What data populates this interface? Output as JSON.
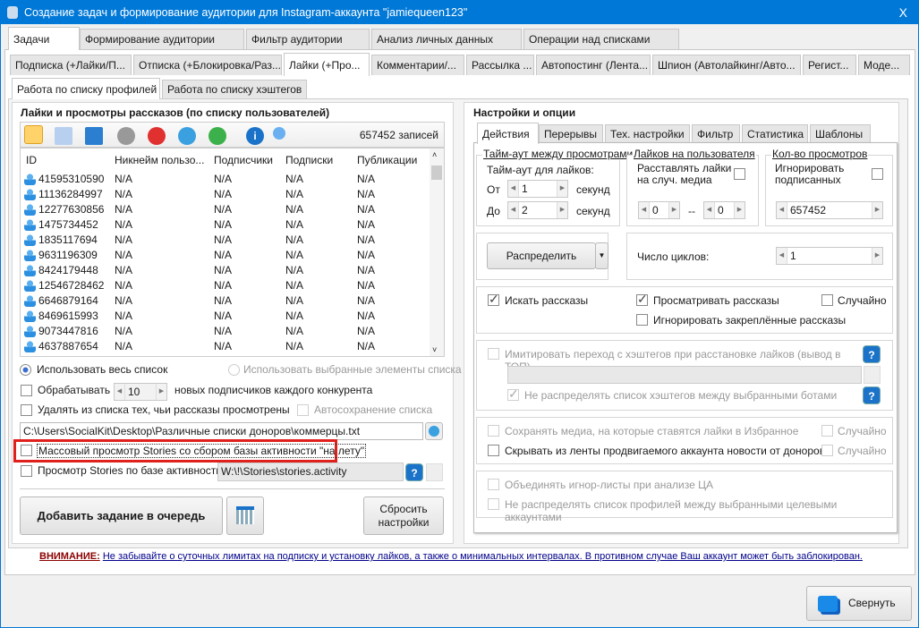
{
  "window": {
    "title": "Создание задач и формирование аудитории для Instagram-аккаунта \"jamiequeen123\"",
    "close": "X"
  },
  "main_tabs": [
    "Задачи",
    "Формирование аудитории",
    "Фильтр аудитории",
    "Анализ личных данных",
    "Операции над списками"
  ],
  "sub_tabs": [
    "Подписка (+Лайки/П...",
    "Отписка (+Блокировка/Раз...",
    "Лайки (+Про...",
    "Комментарии/...",
    "Рассылка ...",
    "Автопостинг (Лента...",
    "Шпион (Автолайкинг/Авто...",
    "Регист...",
    "Моде..."
  ],
  "mode_tabs": [
    "Работа по списку профилей",
    "Работа по списку хэштегов"
  ],
  "left": {
    "title": "Лайки и просмотры рассказов (по списку пользователей)",
    "record_count": "657452 записей",
    "columns": [
      "ID",
      "Никнейм пользо...",
      "Подписчики",
      "Подписки",
      "Публикации"
    ],
    "rows": [
      [
        "41595310590",
        "N/A",
        "N/A",
        "N/A",
        "N/A"
      ],
      [
        "11136284997",
        "N/A",
        "N/A",
        "N/A",
        "N/A"
      ],
      [
        "12277630856",
        "N/A",
        "N/A",
        "N/A",
        "N/A"
      ],
      [
        "1475734452",
        "N/A",
        "N/A",
        "N/A",
        "N/A"
      ],
      [
        "1835117694",
        "N/A",
        "N/A",
        "N/A",
        "N/A"
      ],
      [
        "9631196309",
        "N/A",
        "N/A",
        "N/A",
        "N/A"
      ],
      [
        "8424179448",
        "N/A",
        "N/A",
        "N/A",
        "N/A"
      ],
      [
        "12546728462",
        "N/A",
        "N/A",
        "N/A",
        "N/A"
      ],
      [
        "6646879164",
        "N/A",
        "N/A",
        "N/A",
        "N/A"
      ],
      [
        "8469615993",
        "N/A",
        "N/A",
        "N/A",
        "N/A"
      ],
      [
        "9073447816",
        "N/A",
        "N/A",
        "N/A",
        "N/A"
      ],
      [
        "4637887654",
        "N/A",
        "N/A",
        "N/A",
        "N/A"
      ]
    ],
    "radio_all": "Использовать весь список",
    "radio_selected": "Использовать выбранные элементы списка",
    "process_label": "Обрабатывать",
    "process_value": "10",
    "process_suffix": "новых подписчиков каждого конкурента",
    "remove_label": "Удалять из списка тех, чьи рассказы просмотрены",
    "autosave_label": "Автосохранение списка",
    "path": "C:\\Users\\SocialKit\\Desktop\\Различные списки доноров\\коммерцы.txt",
    "mass_view_label": "Массовый просмотр Stories со сбором базы активности \"на лету\"",
    "activity_label": "Просмотр Stories по базе активности:",
    "activity_path": "W:\\!\\Stories\\stories.activity",
    "add_task": "Добавить задание в очередь",
    "reset": [
      "Сбросить",
      "настройки"
    ]
  },
  "right": {
    "title": "Настройки и опции",
    "tabs": [
      "Действия",
      "Перерывы",
      "Тех. настройки",
      "Фильтр",
      "Статистика",
      "Шаблоны"
    ],
    "timeout_title": "Тайм-аут между просмотрами",
    "timeout_label": "Тайм-аут для лайков:",
    "from": "От",
    "to": "До",
    "from_val": "1",
    "to_val": "2",
    "sec": "секунд",
    "likes_title": "Лайков на пользователя",
    "likes_random": [
      "Расставлять лайки",
      "на случ. медиа"
    ],
    "likes_min": "0",
    "likes_sep": "--",
    "likes_max": "0",
    "views_title": "Кол-во просмотров",
    "ignore_subs": [
      "Игнорировать",
      "подписанных"
    ],
    "views_val": "657452",
    "distribute": "Распределить",
    "cycles_label": "Число циклов:",
    "cycles_val": "1",
    "search_stories": "Искать рассказы",
    "view_stories": "Просматривать рассказы",
    "random": "Случайно",
    "ignore_pinned": "Игнорировать закреплённые рассказы",
    "imitate_hashtags": "Имитировать переход с хэштегов при расстановке лайков (вывод в ТОП)",
    "no_distribute_hashtags": "Не распределять список хэштегов между выбранными ботами",
    "save_media": "Сохранять медиа, на которые ставятся лайки в Избранное",
    "hide_feed": "Скрывать из ленты продвигаемого аккаунта новости от доноров",
    "merge_ignore": "Объединять игнор-листы при анализе ЦА",
    "no_distribute_profiles": "Не распределять список профилей между выбранными целевыми аккаунтами"
  },
  "warning": {
    "label": "ВНИМАНИЕ:",
    "text": "Не забывайте о суточных лимитах на подписку и установку лайков, а также о минимальных интервалах. В противном случае Ваш аккаунт может быть заблокирован."
  },
  "minimize": "Свернуть",
  "colors": {
    "titlebar": "#0078d7",
    "highlight": "#e0201c",
    "warning_label": "#8b0000",
    "link": "#00008b"
  }
}
